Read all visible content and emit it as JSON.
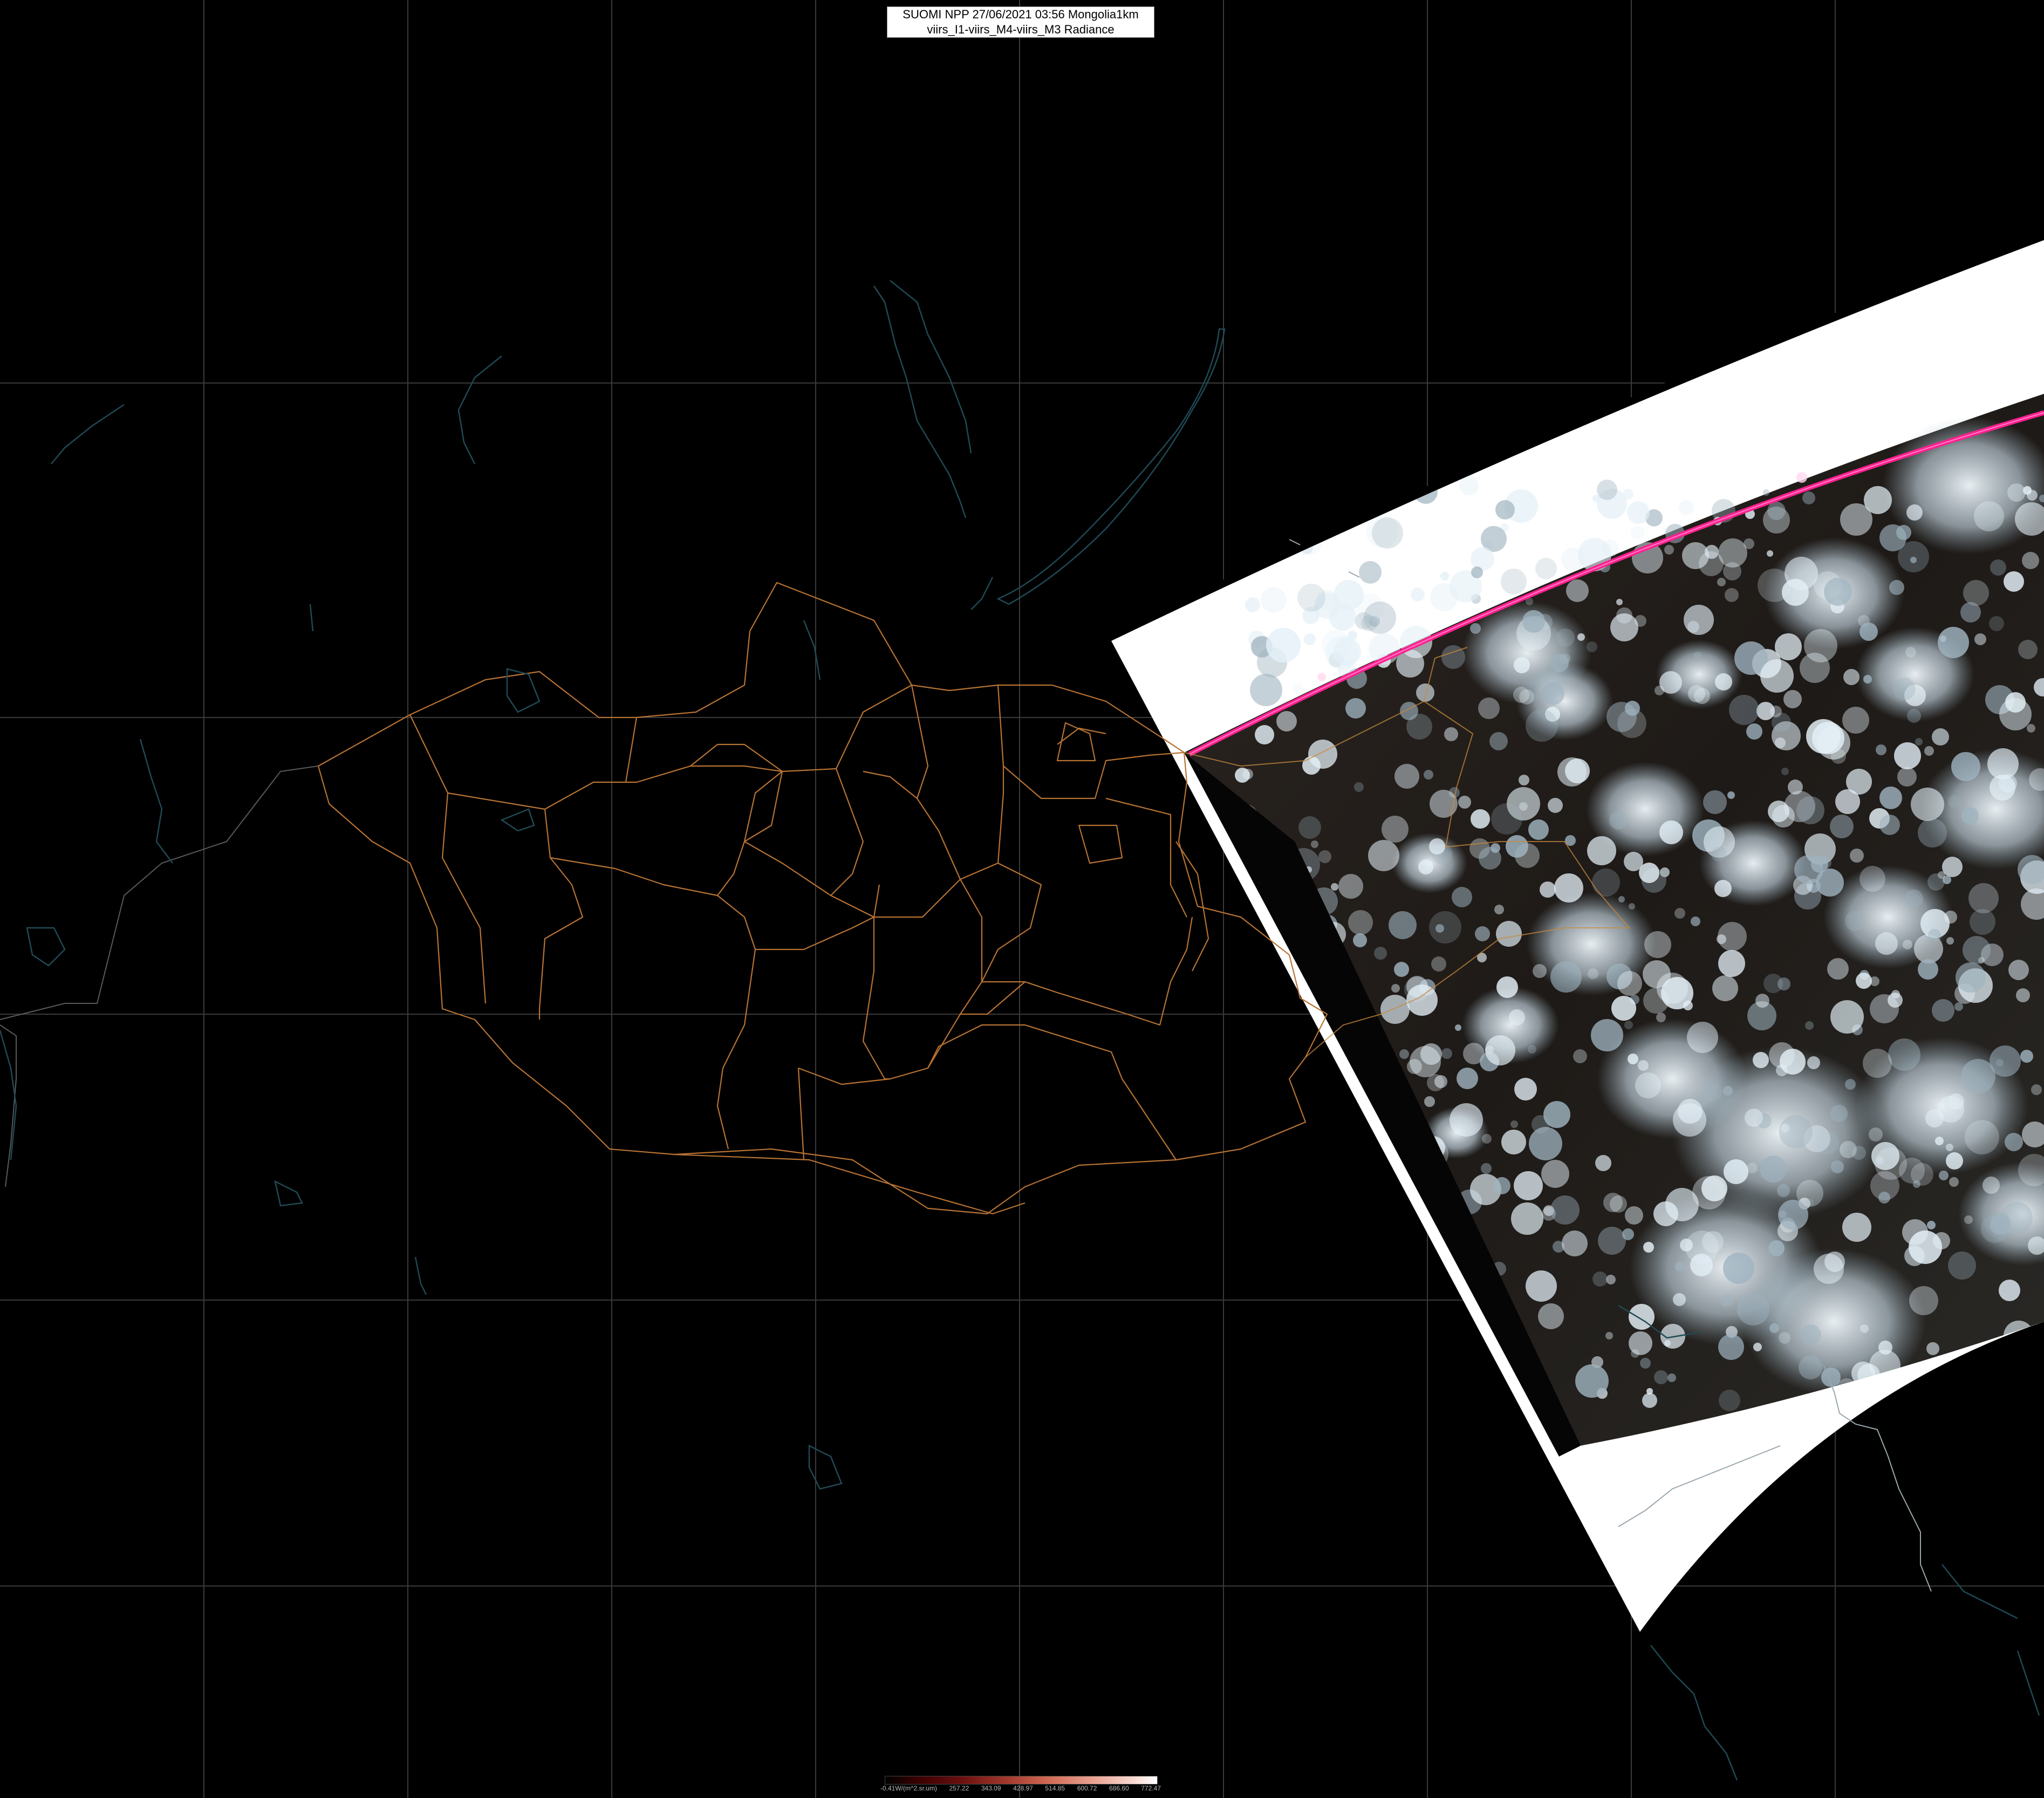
{
  "header": {
    "line1": "SUOMI NPP 27/06/2021 03:56 Mongolia1km",
    "line2": "viirs_I1-viirs_M4-viirs_M3 Radiance"
  },
  "legend": {
    "labels": [
      "-0.41W/(m^2.sr.um)",
      "257.22",
      "343.09",
      "428.97",
      "514.85",
      "600.72",
      "686.60",
      "772.47"
    ],
    "colors": [
      "#000000",
      "#6a0f0f",
      "#cf6a55",
      "#ffffff"
    ]
  },
  "colors": {
    "background": "#000000",
    "grid": "#3a3a3a",
    "borders": "#b87333",
    "water": "#1f4a55",
    "swath_nodata": "#ffffff",
    "orbit_track": "#ff1f8f",
    "land_dark": "#2a221c",
    "cloud": "#dcecf5"
  }
}
